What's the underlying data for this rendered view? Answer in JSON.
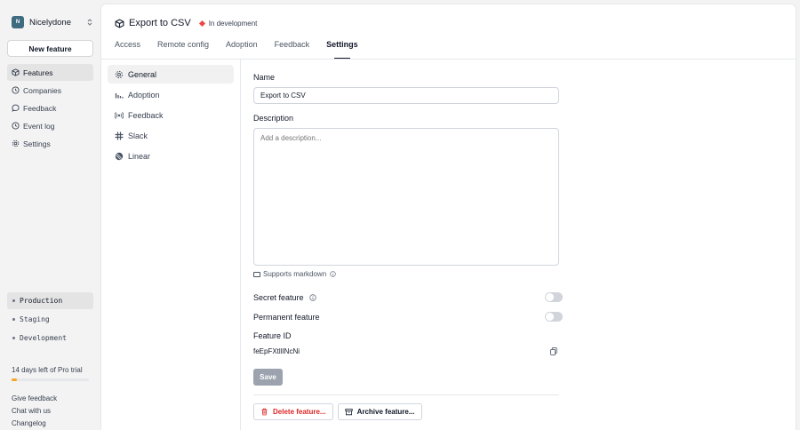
{
  "workspace": {
    "initial": "N",
    "name": "Nicelydone"
  },
  "sidebar": {
    "new_feature_label": "New feature",
    "nav": [
      {
        "label": "Features",
        "icon": "package-icon"
      },
      {
        "label": "Companies",
        "icon": "clock-icon"
      },
      {
        "label": "Feedback",
        "icon": "chat-icon"
      },
      {
        "label": "Event log",
        "icon": "clock-icon"
      },
      {
        "label": "Settings",
        "icon": "gear-icon"
      }
    ],
    "environments": [
      "Production",
      "Staging",
      "Development"
    ],
    "trial": {
      "label": "14 days left of Pro trial",
      "progress": 0.07
    },
    "footer": {
      "give_feedback": "Give feedback",
      "chat": "Chat with us",
      "changelog": "Changelog"
    }
  },
  "header": {
    "title": "Export to CSV",
    "status": "In development",
    "tabs": [
      "Access",
      "Remote config",
      "Adoption",
      "Feedback",
      "Settings"
    ],
    "active_tab": "Settings"
  },
  "subnav": {
    "items": [
      "General",
      "Adoption",
      "Feedback",
      "Slack",
      "Linear"
    ],
    "active": "General"
  },
  "form": {
    "name_label": "Name",
    "name_value": "Export to CSV",
    "description_label": "Description",
    "description_placeholder": "Add a description...",
    "markdown_label": "Supports markdown",
    "secret_label": "Secret feature",
    "permanent_label": "Permanent feature",
    "feature_id_label": "Feature ID",
    "feature_id_value": "feEpFXtlIlNcNi",
    "save_label": "Save",
    "delete_label": "Delete feature...",
    "archive_label": "Archive feature..."
  },
  "colors": {
    "status_dot": "#ef4444",
    "trial_bar": "#f5a623",
    "workspace_logo": "#3e6b80",
    "delete_text": "#dc2626"
  }
}
